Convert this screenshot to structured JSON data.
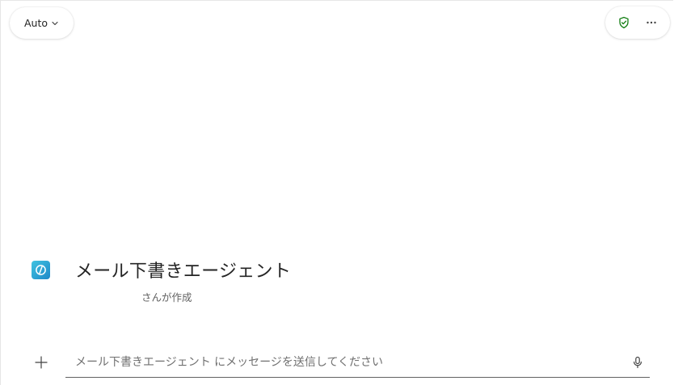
{
  "header": {
    "model_selector": {
      "label": "Auto",
      "icon": "chevron-down-icon"
    },
    "actions": [
      {
        "icon": "shield-check-icon",
        "color": "#107c10"
      },
      {
        "icon": "more-horizontal-icon",
        "color": "#424242"
      }
    ]
  },
  "agent": {
    "logo_icon": "copilot-agent-logo",
    "title": "メール下書きエージェント",
    "creator_suffix": "さんが作成"
  },
  "composer": {
    "add_icon": "plus-icon",
    "placeholder": "メール下書きエージェント にメッセージを送信してください",
    "value": "",
    "mic_icon": "microphone-icon"
  },
  "colors": {
    "text": "#242424",
    "secondary_text": "#616161",
    "accent_green": "#107c10",
    "logo_gradient_start": "#3fc3e0",
    "logo_gradient_end": "#1e88c8"
  }
}
